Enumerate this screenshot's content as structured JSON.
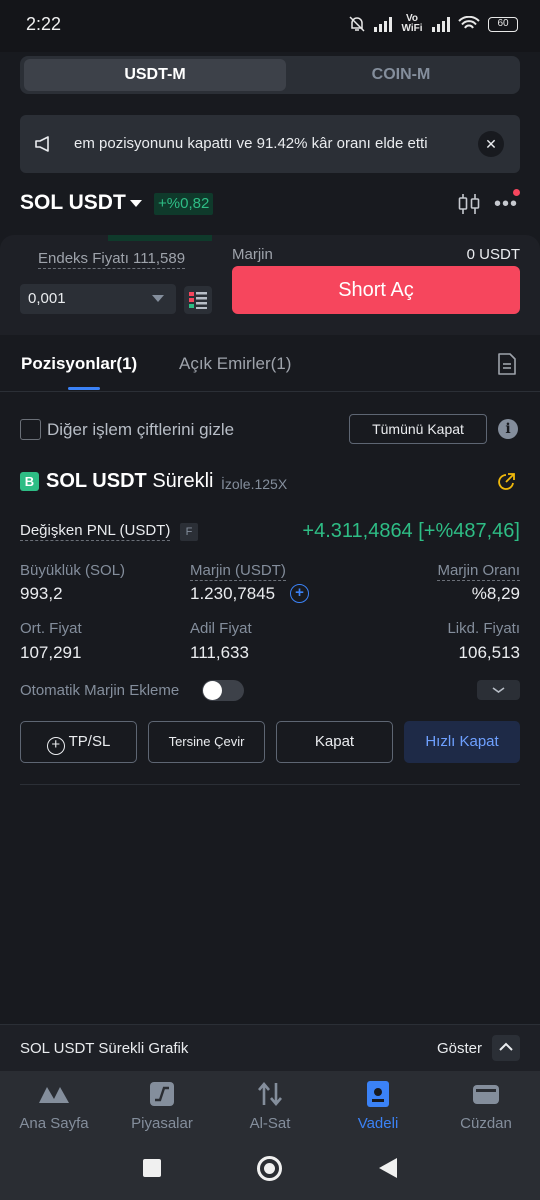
{
  "status_bar": {
    "time": "2:22",
    "network_label": "Vo WiFi",
    "battery": "60"
  },
  "contract_tabs": {
    "active": "USDT-M",
    "inactive": "COIN-M"
  },
  "announcement": {
    "text": "em pozisyonunu kapattı ve 91.42% kâr oranı elde etti"
  },
  "pair": {
    "symbol": "SOL USDT",
    "change": "+%0,82",
    "change_color": "#2ebd85"
  },
  "order": {
    "index_price": "Endeks Fiyatı 111,589",
    "quantity": "0,001",
    "margin_label": "Marjin",
    "margin_value": "0 USDT",
    "short_label": "Short Aç",
    "short_color": "#f6465d"
  },
  "tabs": {
    "positions": "Pozisyonlar(1)",
    "open_orders": "Açık Emirler(1)"
  },
  "filters": {
    "hide_pairs_label": "Diğer işlem çiftlerini gizle",
    "close_all": "Tümünü Kapat"
  },
  "position": {
    "side_badge": "B",
    "symbol": "SOL USDT",
    "type": "Sürekli",
    "mode": "İzole.125X",
    "pnl_label": "Değişken PNL (USDT)",
    "pnl_flag": "F",
    "pnl_value": "+4.311,4864 [+%487,46]",
    "size_label": "Büyüklük (SOL)",
    "size_value": "993,2",
    "margin_label": "Marjin (USDT)",
    "margin_value": "1.230,7845",
    "margin_ratio_label": "Marjin Oranı",
    "margin_ratio_value": "%8,29",
    "entry_label": "Ort. Fiyat",
    "entry_value": "107,291",
    "fair_label": "Adil Fiyat",
    "fair_value": "111,633",
    "liq_label": "Likd. Fiyatı",
    "liq_value": "106,513",
    "auto_margin_label": "Otomatik Marjin Ekleme",
    "buttons": {
      "tpsl": "TP/SL",
      "reverse": "Tersine Çevir",
      "close": "Kapat",
      "quick_close": "Hızlı Kapat"
    }
  },
  "chart_strip": {
    "title": "SOL USDT Sürekli Grafik",
    "show": "Göster"
  },
  "nav": [
    {
      "label": "Ana Sayfa",
      "icon": "home-icon"
    },
    {
      "label": "Piyasalar",
      "icon": "markets-icon"
    },
    {
      "label": "Al-Sat",
      "icon": "trade-icon"
    },
    {
      "label": "Vadeli",
      "icon": "futures-icon"
    },
    {
      "label": "Cüzdan",
      "icon": "wallet-icon"
    }
  ]
}
